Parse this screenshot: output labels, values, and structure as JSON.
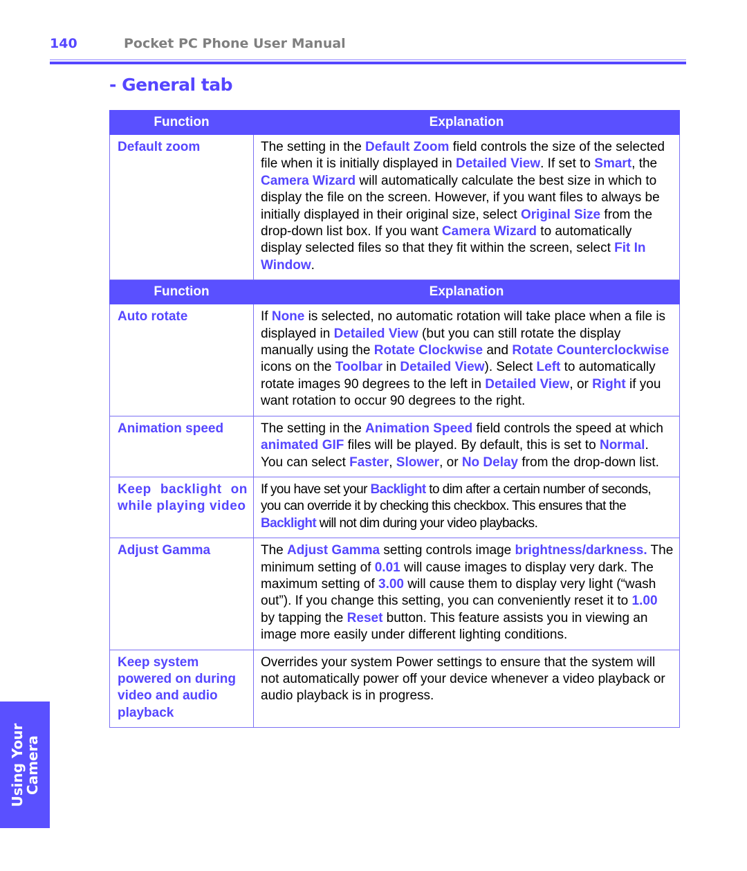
{
  "header": {
    "page_number": "140",
    "manual_title": "Pocket PC Phone User Manual"
  },
  "section_title": "- General tab",
  "table": {
    "col_function": "Function",
    "col_explanation": "Explanation",
    "rows": [
      {
        "function": "Default zoom",
        "explanation": [
          {
            "t": "The setting in the "
          },
          {
            "k": "Default Zoom"
          },
          {
            "t": " field controls the size of the selected file when it is initially displayed in "
          },
          {
            "k": "Detailed View"
          },
          {
            "t": ".  If set to "
          },
          {
            "k": "Smart"
          },
          {
            "t": ", the "
          },
          {
            "k": "Camera Wizard"
          },
          {
            "t": " will automatically calculate the best size in which to display the file on the screen.  However, if you want files to always be initially displayed in their original size, select "
          },
          {
            "k": "Original Size"
          },
          {
            "t": " from the drop-down list box.  If you want "
          },
          {
            "k": "Camera Wizard"
          },
          {
            "t": " to automatically display selected files so that they fit within the screen, select "
          },
          {
            "k": "Fit In Window"
          },
          {
            "t": "."
          }
        ]
      },
      {
        "function": "Auto rotate",
        "explanation": [
          {
            "t": "If "
          },
          {
            "k": "None"
          },
          {
            "t": " is selected, no automatic rotation will take place when a file is displayed in "
          },
          {
            "k": "Detailed View"
          },
          {
            "t": " (but you can still rotate the display manually using the "
          },
          {
            "k": "Rotate Clockwise"
          },
          {
            "t": " and "
          },
          {
            "k": "Rotate Counterclockwise"
          },
          {
            "t": " icons on the "
          },
          {
            "k": "Toolbar"
          },
          {
            "t": " in "
          },
          {
            "k": "Detailed View"
          },
          {
            "t": "). Select "
          },
          {
            "k": "Left"
          },
          {
            "t": " to automatically rotate images 90 degrees to the left in "
          },
          {
            "k": "Detailed View"
          },
          {
            "t": ", or "
          },
          {
            "k": "Right"
          },
          {
            "t": " if you want rotation to occur 90 degrees to the right."
          }
        ]
      },
      {
        "function": "Animation speed",
        "explanation": [
          {
            "t": "The setting in the "
          },
          {
            "k": "Animation Speed"
          },
          {
            "t": " field controls the speed at which "
          },
          {
            "k": "animated GIF"
          },
          {
            "t": " files will be played.  By default, this is set to "
          },
          {
            "k": "Normal"
          },
          {
            "t": ".  You can select "
          },
          {
            "k": "Faster"
          },
          {
            "t": ", "
          },
          {
            "k": "Slower"
          },
          {
            "t": ", or "
          },
          {
            "k": "No Delay"
          },
          {
            "t": " from the drop-down list."
          }
        ]
      },
      {
        "function": "Keep backlight on while playing video",
        "explanation": [
          {
            "t": "If you have set your "
          },
          {
            "k": "Backlight"
          },
          {
            "t": " to dim after a certain number of seconds, you can override it by checking this checkbox.  This ensures that the "
          },
          {
            "k": "Backlight"
          },
          {
            "t": " will not dim during your video playbacks."
          }
        ]
      },
      {
        "function": "Adjust Gamma",
        "explanation": [
          {
            "t": "The "
          },
          {
            "k": "Adjust Gamma"
          },
          {
            "t": " setting controls image "
          },
          {
            "k": "brightness/darkness."
          },
          {
            "t": " The minimum setting of "
          },
          {
            "k": "0.01"
          },
          {
            "t": " will cause images to display very dark. The maximum setting of "
          },
          {
            "k": "3.00"
          },
          {
            "t": " will cause them to display very light (“wash out”).  If you change this setting, you can conveniently reset it to "
          },
          {
            "k": "1.00"
          },
          {
            "t": " by tapping the "
          },
          {
            "k": "Reset"
          },
          {
            "t": " button.  This feature assists you in viewing an image more easily under different lighting conditions."
          }
        ]
      },
      {
        "function": "Keep system powered on during video and audio playback",
        "explanation": [
          {
            "t": "Overrides your system Power settings to ensure that the system will not automatically power off your device whenever a video playback or audio playback is in progress."
          }
        ]
      }
    ]
  },
  "side_tab": {
    "line1": "Using Your",
    "line2": "Camera"
  },
  "colors": {
    "accent": "#5546ff",
    "header_fill": "#5a50ff",
    "muted_title": "#7f7f7f"
  }
}
